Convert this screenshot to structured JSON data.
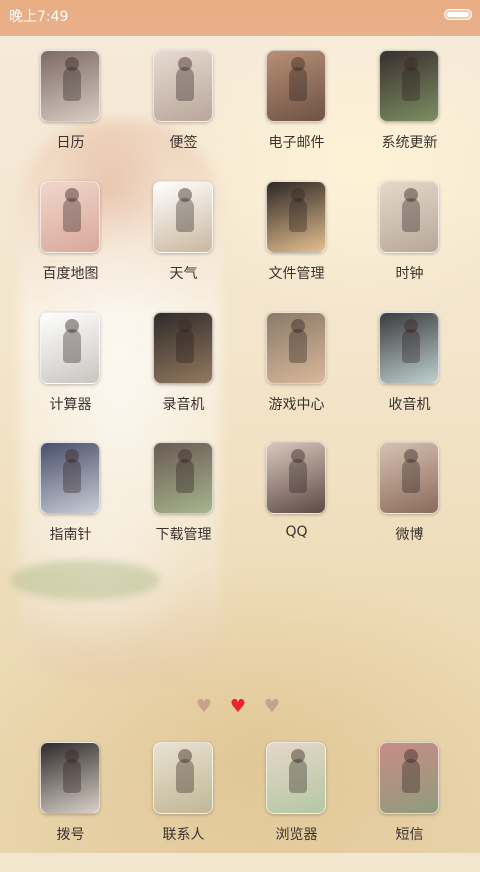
{
  "status_bar": {
    "time": "晚上7:49",
    "background": "#e9ad83"
  },
  "apps": [
    {
      "id": "calendar",
      "label": "日历",
      "colors": [
        "#d8ccc3",
        "#7d6a63"
      ]
    },
    {
      "id": "notes",
      "label": "便签",
      "colors": [
        "#b9a69a",
        "#e7dad0"
      ]
    },
    {
      "id": "email",
      "label": "电子邮件",
      "colors": [
        "#6f5246",
        "#b68f75"
      ]
    },
    {
      "id": "system-update",
      "label": "系统更新",
      "colors": [
        "#7c8f62",
        "#3a2f2e"
      ]
    },
    {
      "id": "baidu-map",
      "label": "百度地图",
      "colors": [
        "#d8a89a",
        "#f1d6cb"
      ]
    },
    {
      "id": "weather",
      "label": "天气",
      "colors": [
        "#c9b79d",
        "#ffffff"
      ]
    },
    {
      "id": "file-manager",
      "label": "文件管理",
      "colors": [
        "#e5c090",
        "#2d2725"
      ]
    },
    {
      "id": "clock",
      "label": "时钟",
      "colors": [
        "#b7a79a",
        "#e5d8c9"
      ]
    },
    {
      "id": "calculator",
      "label": "计算器",
      "colors": [
        "#c9c4c0",
        "#ffffff"
      ]
    },
    {
      "id": "recorder",
      "label": "录音机",
      "colors": [
        "#94795f",
        "#2f2b2b"
      ]
    },
    {
      "id": "game-center",
      "label": "游戏中心",
      "colors": [
        "#d9b79a",
        "#8a7a68"
      ]
    },
    {
      "id": "radio",
      "label": "收音机",
      "colors": [
        "#bfd0cf",
        "#3b3b3f"
      ]
    },
    {
      "id": "compass",
      "label": "指南针",
      "colors": [
        "#c9cdd6",
        "#4a4f6b"
      ]
    },
    {
      "id": "download-manager",
      "label": "下载管理",
      "colors": [
        "#a7b58c",
        "#6a5a55"
      ]
    },
    {
      "id": "qq",
      "label": "QQ",
      "colors": [
        "#5e4a45",
        "#d9c6bb"
      ]
    },
    {
      "id": "weibo",
      "label": "微博",
      "colors": [
        "#8b6a5a",
        "#d6c1b2"
      ]
    }
  ],
  "page_indicator": {
    "pages": 3,
    "current": 2,
    "active_color": "#e8262a",
    "inactive_color": "#c8a08e"
  },
  "dock": [
    {
      "id": "dialer",
      "label": "拨号",
      "colors": [
        "#d9d1c8",
        "#2f2a2b"
      ]
    },
    {
      "id": "contacts",
      "label": "联系人",
      "colors": [
        "#c0b796",
        "#e9e2d0"
      ]
    },
    {
      "id": "browser",
      "label": "浏览器",
      "colors": [
        "#b3c7a3",
        "#e6d7c8"
      ]
    },
    {
      "id": "sms",
      "label": "短信",
      "colors": [
        "#8e9c7c",
        "#c98b86"
      ]
    }
  ]
}
